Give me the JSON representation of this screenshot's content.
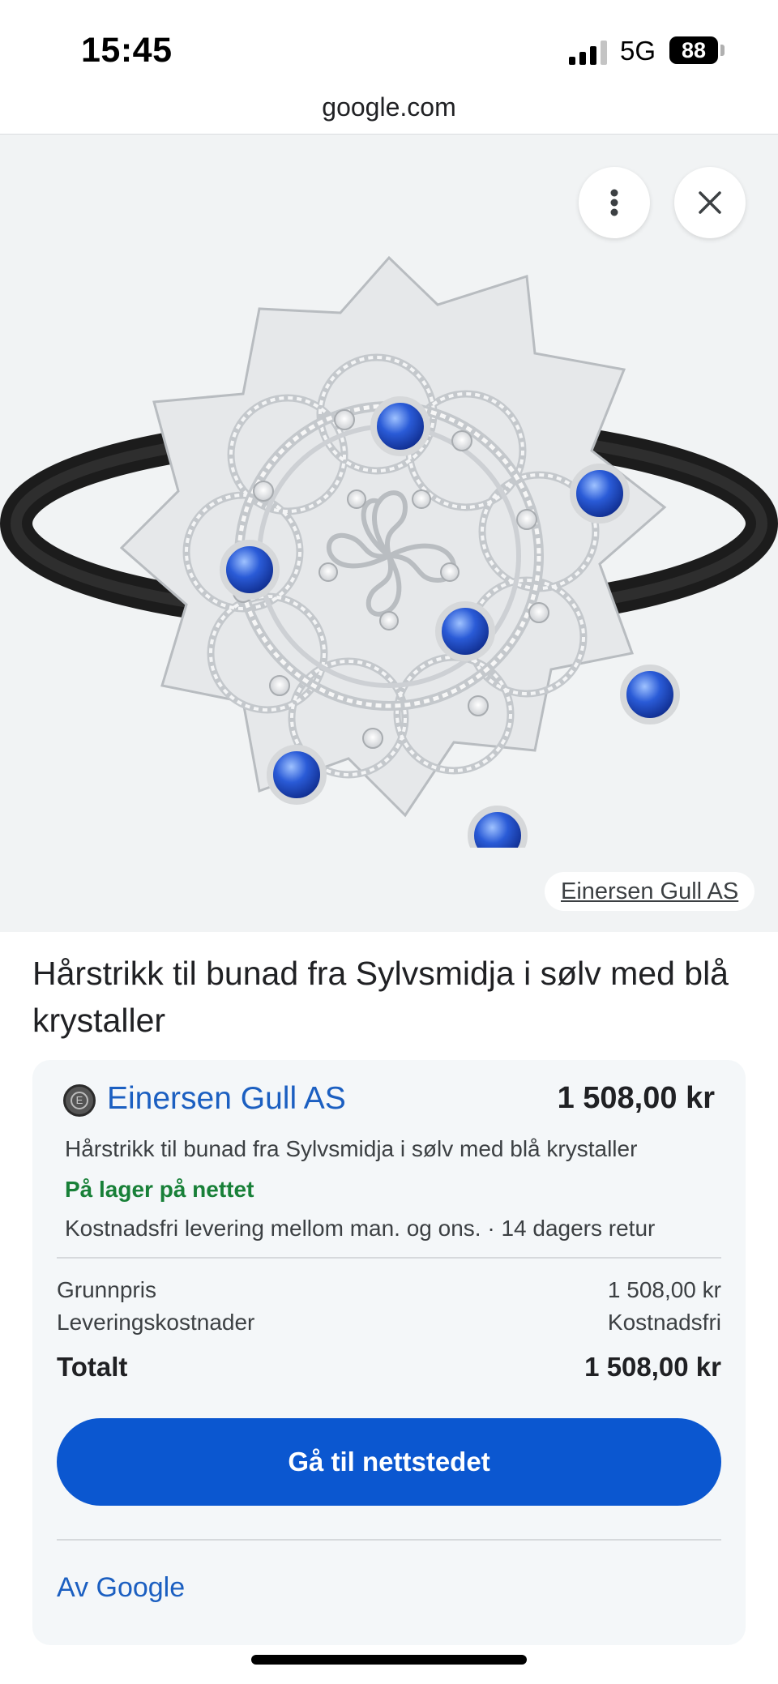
{
  "status_bar": {
    "time": "15:45",
    "network": "5G",
    "battery": "88"
  },
  "browser": {
    "url": "google.com"
  },
  "image_viewer": {
    "menu_icon": "more-vertical-icon",
    "close_icon": "close-icon",
    "source_chip": "Einersen Gull AS"
  },
  "product": {
    "title": "Hårstrikk til bunad fra Sylvsmidja i sølv med blå krystaller"
  },
  "offer": {
    "seller_name": "Einersen Gull AS",
    "price": "1 508,00 kr",
    "description": "Hårstrikk til bunad fra Sylvsmidja i sølv med blå krystaller",
    "stock": "På lager på nettet",
    "delivery": "Kostnadsfri levering mellom man. og ons. · 14 dagers retur",
    "base_price_label": "Grunnpris",
    "base_price_value": "1 508,00 kr",
    "shipping_label": "Leveringskostnader",
    "shipping_value": "Kostnadsfri",
    "total_label": "Totalt",
    "total_value": "1 508,00 kr",
    "cta_label": "Gå til nettstedet",
    "footer_link": "Av Google"
  },
  "colors": {
    "link_blue": "#1b5fc1",
    "cta_blue": "#0b57d0",
    "stock_green": "#188038",
    "gem_blue": "#2a5bd7"
  }
}
